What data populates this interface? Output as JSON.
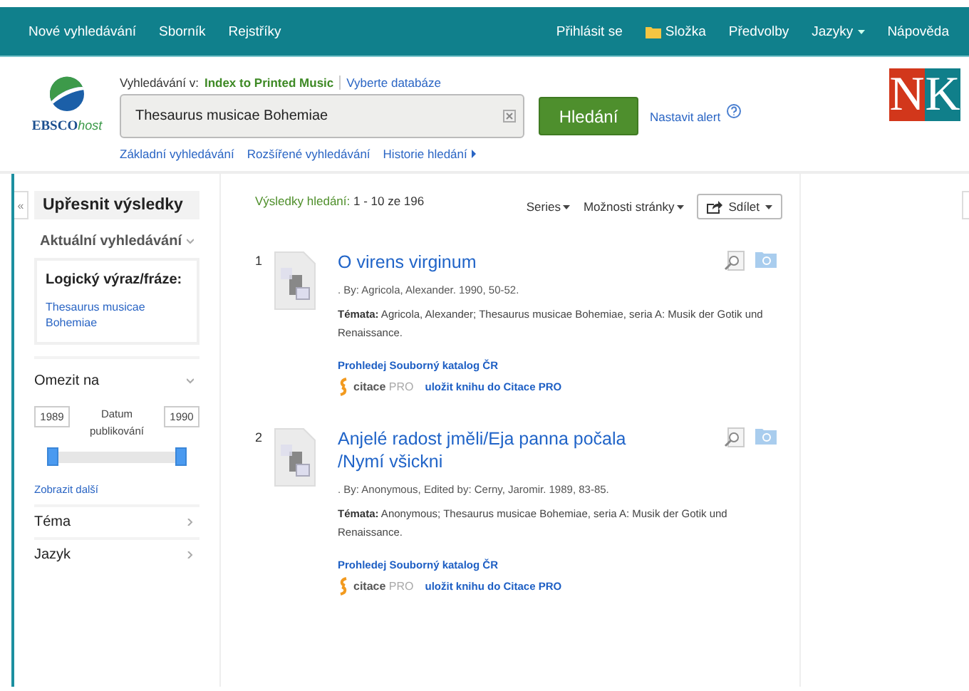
{
  "top_nav": {
    "left": [
      {
        "label": "Nové vyhledávání"
      },
      {
        "label": "Sborník"
      },
      {
        "label": "Rejstříky"
      }
    ],
    "right": [
      {
        "label": "Přihlásit se",
        "kind": "plain"
      },
      {
        "label": "Složka",
        "kind": "folder"
      },
      {
        "label": "Předvolby",
        "kind": "plain"
      },
      {
        "label": "Jazyky",
        "kind": "dropdown"
      },
      {
        "label": "Nápověda",
        "kind": "plain"
      }
    ]
  },
  "header": {
    "logo": {
      "main": "EBSCO",
      "suffix": "host"
    },
    "search_in_label": "Vyhledávání v:",
    "database": "Index to Printed Music",
    "choose_database": "Vyberte databáze",
    "search": {
      "value": "Thesaurus musicae Bohemiae"
    },
    "search_button": "Hledání",
    "alert_link": "Nastavit alert",
    "links": [
      {
        "label": "Základní vyhledávání",
        "kind": "plain"
      },
      {
        "label": "Rozšířené vyhledávání",
        "kind": "plain"
      },
      {
        "label": "Historie hledání",
        "kind": "arrow"
      }
    ],
    "library_logo": {
      "left": "N",
      "right": "K"
    }
  },
  "sidebar": {
    "collapse": "«",
    "title": "Upřesnit výsledky",
    "current": {
      "heading": "Aktuální vyhledávání",
      "expanded": true,
      "box_title": "Logický výraz/fráze:",
      "term": "Thesaurus musicae Bohemiae"
    },
    "limit": {
      "heading": "Omezit na",
      "expanded": true,
      "from": "1989",
      "to": "1990",
      "label": "Datum publikování",
      "thumbs": [
        {
          "level": 0
        },
        {
          "level": 1
        }
      ],
      "more": "Zobrazit další"
    },
    "facets": [
      {
        "label": "Téma",
        "expanded": false
      },
      {
        "label": "Jazyk",
        "expanded": false
      }
    ]
  },
  "results": {
    "summary_label": "Výsledky hledání:",
    "summary": "1 - 10 ze 196",
    "sort": "Series",
    "page_options": "Možnosti stránky",
    "share": "Sdílet",
    "items": [
      {
        "number": "1",
        "title": "O virens virginum",
        "meta": ". By: Agricola, Alexander. 1990, 50-52.",
        "subjects_label": "Témata:",
        "subjects": "Agricola, Alexander; Thesaurus musicae Bohemiae, seria A: Musik der Gotik und Renaissance.",
        "catalog_link": "Prohledej Souborný katalog ČR",
        "citace": "citace",
        "citace_pro": "PRO",
        "save_link": "uložit knihu do Citace PRO"
      },
      {
        "number": "2",
        "title": "Anjelé radost jměli/Eja panna počala /Nymí všickni",
        "meta": ". By: Anonymous, Edited by: Cerny, Jaromir. 1989, 83-85.",
        "subjects_label": "Témata:",
        "subjects": "Anonymous; Thesaurus musicae Bohemiae, seria A: Musik der Gotik und Renaissance.",
        "catalog_link": "Prohledej Souborný katalog ČR",
        "citace": "citace",
        "citace_pro": "PRO",
        "save_link": "uložit knihu do Citace PRO"
      }
    ]
  }
}
